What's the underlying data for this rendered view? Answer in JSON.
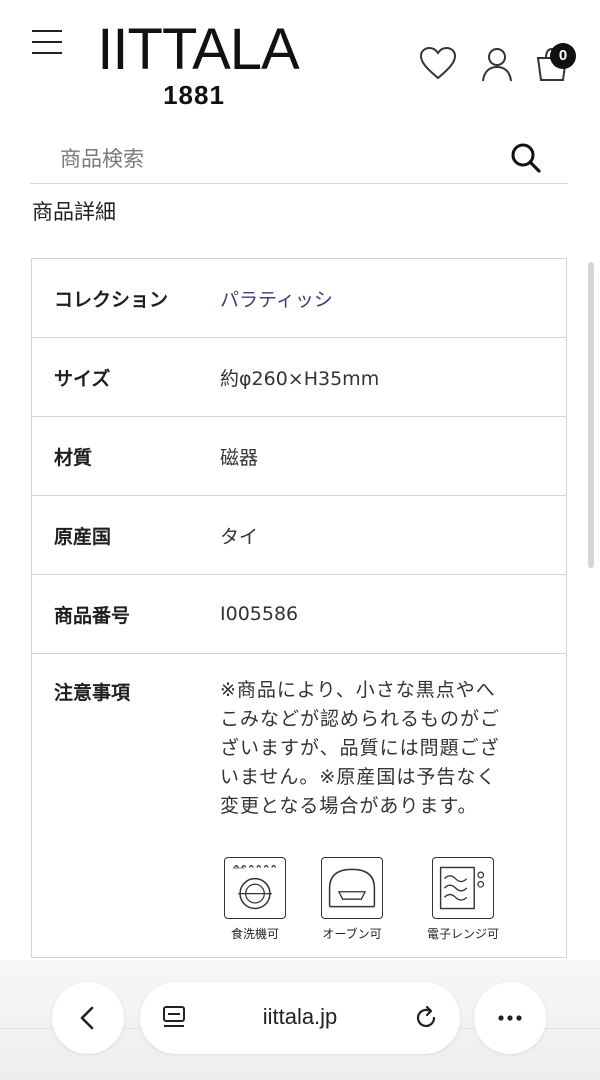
{
  "header": {
    "brand": "IITTALA",
    "year": "1881",
    "cart_count": "0"
  },
  "search": {
    "placeholder": "商品検索"
  },
  "section_title": "商品詳細",
  "details": [
    {
      "label": "コレクション",
      "value": "パラティッシ"
    },
    {
      "label": "サイズ",
      "value": "約φ260×H35mm"
    },
    {
      "label": "材質",
      "value": "磁器"
    },
    {
      "label": "原産国",
      "value": "タイ"
    },
    {
      "label": "商品番号",
      "value": "I005586"
    }
  ],
  "notes": {
    "label": "注意事項",
    "lines": [
      "※商品により、小さな黒点やへ",
      "こみなどが認められるものがご",
      "ざいますが、品質には問題ござ",
      "いません。※原産国は予告なく",
      "変更となる場合があります。"
    ],
    "care": [
      {
        "icon": "dishwasher-icon",
        "label": "食洗機可"
      },
      {
        "icon": "oven-icon",
        "label": "オーブン可"
      },
      {
        "icon": "microwave-icon",
        "label": "電子レンジ可"
      }
    ]
  },
  "browser": {
    "url": "iittala.jp"
  },
  "colors": {
    "link": "#3a3f7a",
    "border": "#d4d4d4",
    "badge": "#111111"
  }
}
